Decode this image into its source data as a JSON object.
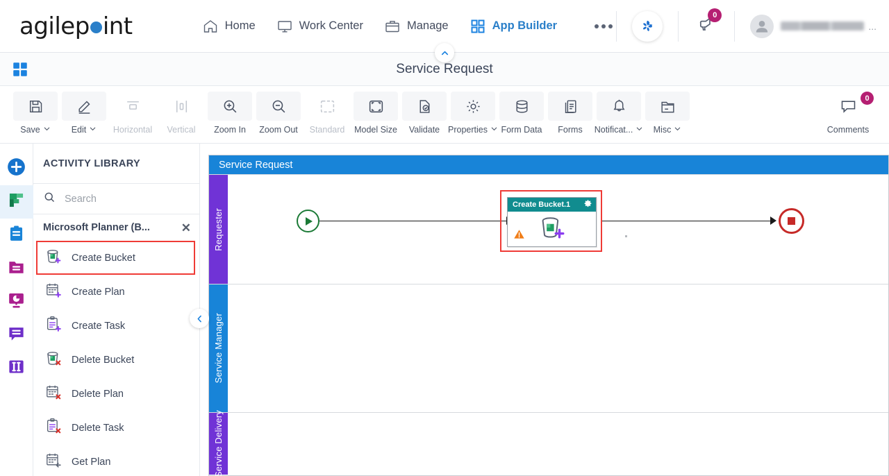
{
  "brand": {
    "name_part1": "agilep",
    "name_part2": "int",
    "dot_color": "#2a7fc9"
  },
  "topnav": {
    "items": [
      {
        "label": "Home",
        "icon": "home-icon",
        "active": false
      },
      {
        "label": "Work Center",
        "icon": "monitor-icon",
        "active": false
      },
      {
        "label": "Manage",
        "icon": "briefcase-icon",
        "active": false
      },
      {
        "label": "App Builder",
        "icon": "grid-icon",
        "active": true
      }
    ],
    "overflow": "...",
    "app_switcher_icon": "agilepoint-pinwheel-icon",
    "announcements": {
      "icon": "megaphone-icon",
      "count": "0",
      "badge_color": "#b51f72"
    },
    "user": {
      "name": "",
      "avatar_icon": "user-avatar-icon",
      "menu": "..."
    }
  },
  "appbar": {
    "grid_icon": "apps-grid-icon",
    "title": "Service Request",
    "collapse_icon": "chevron-up-icon"
  },
  "toolbar": {
    "items": [
      {
        "label": "Save",
        "icon": "save-floppy-icon",
        "caret": "⌄",
        "disabled": false,
        "boxed": true
      },
      {
        "label": "Edit",
        "icon": "pencil-icon",
        "caret": "⌄",
        "disabled": false,
        "boxed": true
      },
      {
        "label": "Horizontal",
        "icon": "horizontal-layout-icon",
        "caret": "",
        "disabled": true,
        "boxed": true
      },
      {
        "label": "Vertical",
        "icon": "vertical-layout-icon",
        "caret": "",
        "disabled": true,
        "boxed": true
      },
      {
        "label": "Zoom In",
        "icon": "zoom-in-icon",
        "caret": "",
        "disabled": false,
        "boxed": true
      },
      {
        "label": "Zoom Out",
        "icon": "zoom-out-icon",
        "caret": "",
        "disabled": false,
        "boxed": true
      },
      {
        "label": "Standard",
        "icon": "standard-size-icon",
        "caret": "",
        "disabled": true,
        "boxed": true
      },
      {
        "label": "Model Size",
        "icon": "model-size-icon",
        "caret": "",
        "disabled": false,
        "boxed": true
      },
      {
        "label": "Validate",
        "icon": "validate-check-icon",
        "caret": "",
        "disabled": false,
        "boxed": true
      },
      {
        "label": "Properties",
        "icon": "gear-icon",
        "caret": "⌄",
        "disabled": false,
        "boxed": true
      },
      {
        "label": "Form Data",
        "icon": "database-icon",
        "caret": "",
        "disabled": false,
        "boxed": true
      },
      {
        "label": "Forms",
        "icon": "forms-document-icon",
        "caret": "",
        "disabled": false,
        "boxed": true
      },
      {
        "label": "Notificat...",
        "icon": "bell-icon",
        "caret": "⌄",
        "disabled": false,
        "boxed": true
      },
      {
        "label": "Misc",
        "icon": "folder-misc-icon",
        "caret": "⌄",
        "disabled": false,
        "boxed": true
      }
    ],
    "comments": {
      "label": "Comments",
      "icon": "comment-bubble-icon",
      "count": "0",
      "badge_color": "#b51f72"
    }
  },
  "rail": {
    "items": [
      {
        "name": "add-activity-button",
        "icon": "plus-circle-icon",
        "active": false
      },
      {
        "name": "planner-activities",
        "icon": "planner-icon",
        "active": true
      },
      {
        "name": "task-activities",
        "icon": "clipboard-icon",
        "active": false
      },
      {
        "name": "document-activities",
        "icon": "folder-icon",
        "active": false
      },
      {
        "name": "report-activities",
        "icon": "chart-monitor-icon",
        "active": false
      },
      {
        "name": "message-activities",
        "icon": "speech-bubble-icon",
        "active": false
      },
      {
        "name": "column-activities",
        "icon": "columns-icon",
        "active": false
      }
    ]
  },
  "library": {
    "title": "ACTIVITY LIBRARY",
    "search": {
      "placeholder": "Search",
      "value": "",
      "icon": "search-icon"
    },
    "group": {
      "label": "Microsoft Planner (B...",
      "close_icon": "close-icon"
    },
    "items": [
      {
        "label": "Create Bucket",
        "icon": "create-bucket-icon",
        "highlighted": true
      },
      {
        "label": "Create Plan",
        "icon": "create-plan-icon",
        "highlighted": false
      },
      {
        "label": "Create Task",
        "icon": "create-task-icon",
        "highlighted": false
      },
      {
        "label": "Delete Bucket",
        "icon": "delete-bucket-icon",
        "highlighted": false
      },
      {
        "label": "Delete Plan",
        "icon": "delete-plan-icon",
        "highlighted": false
      },
      {
        "label": "Delete Task",
        "icon": "delete-task-icon",
        "highlighted": false
      },
      {
        "label": "Get Plan",
        "icon": "get-plan-icon",
        "highlighted": false
      }
    ],
    "collapse_icon": "chevron-left-icon"
  },
  "canvas": {
    "model_title": "Service Request",
    "lanes": [
      {
        "label": "Requester",
        "color": "#7033d6"
      },
      {
        "label": "Service Manager",
        "color": "#1884d8"
      },
      {
        "label": "Service Delivery",
        "color": "#7033d6"
      }
    ],
    "nodes": {
      "start": {
        "name": "start-event",
        "icon": "play-triangle-icon",
        "color": "#1b7a36"
      },
      "task": {
        "title": "Create Bucket.1",
        "header_color": "#118c8f",
        "gear_icon": "gear-icon",
        "body_icon": "create-bucket-icon",
        "warning_icon": "warning-triangle-icon",
        "selected": true,
        "selection_color": "#ef3b36"
      },
      "end": {
        "name": "end-event",
        "icon": "stop-square-icon",
        "color": "#c62a28"
      }
    }
  }
}
